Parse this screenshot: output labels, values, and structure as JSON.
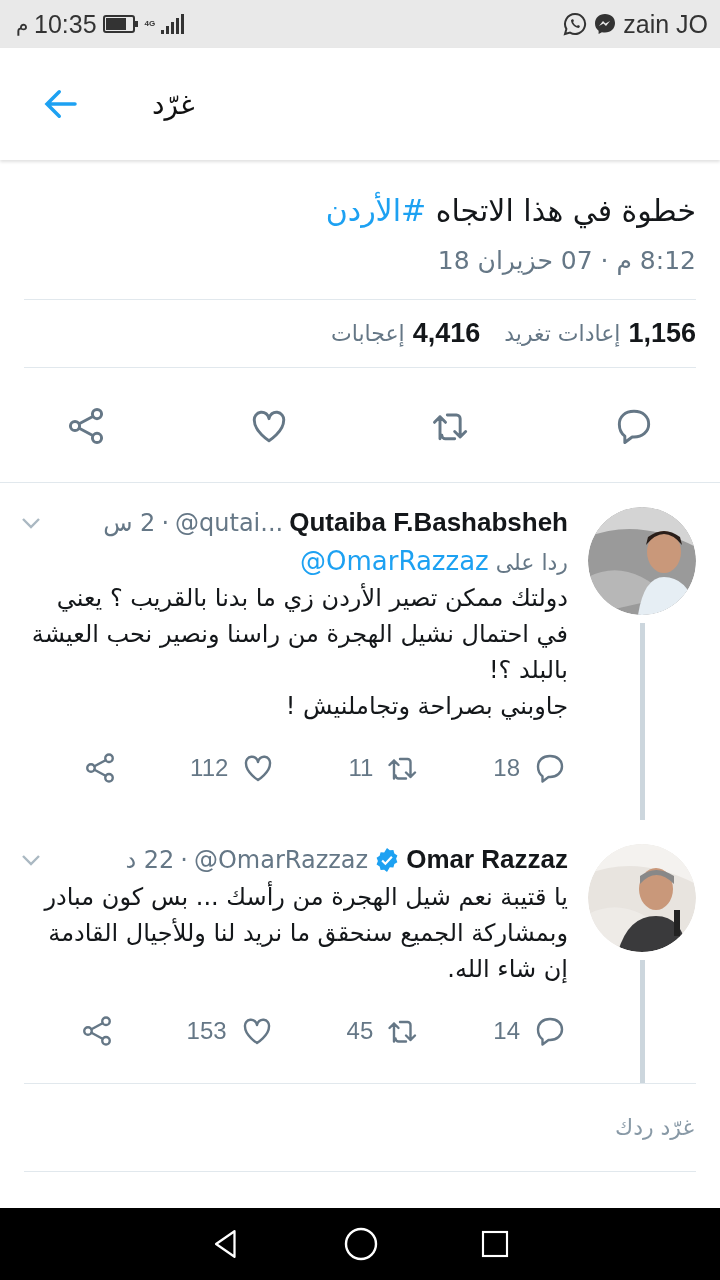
{
  "status_bar": {
    "carrier": "zain JO",
    "network": "4G",
    "time": "10:35",
    "time_suffix": "م"
  },
  "header": {
    "title": "غرّد"
  },
  "tweet": {
    "text": "خطوة في هذا الاتجاه",
    "hashtag": "#الأردن",
    "timestamp": "8:12 م · 07 حزيران 18",
    "stats": [
      {
        "count": "1,156",
        "label": "إعادات تغريد"
      },
      {
        "count": "4,416",
        "label": "إعجابات"
      }
    ],
    "actions": [
      {
        "kind": "reply"
      },
      {
        "kind": "retweet"
      },
      {
        "kind": "like"
      },
      {
        "kind": "share"
      }
    ]
  },
  "replies": [
    {
      "name": "Qutaiba F.Bashabsheh",
      "verified": false,
      "handle": "@qutai...",
      "separator": "·",
      "time": "2 س",
      "reply_prefix": "ردا على",
      "reply_to": "@OmarRazzaz",
      "text": "دولتك ممكن تصير الأردن زي ما بدنا بالقريب ؟ يعني في احتمال نشيل الهجرة من راسنا ونصير نحب العيشة بالبلد ؟!\nجاوبني بصراحة وتجاملنيش !",
      "actions": [
        {
          "kind": "reply",
          "count": "18"
        },
        {
          "kind": "retweet",
          "count": "11"
        },
        {
          "kind": "like",
          "count": "112"
        },
        {
          "kind": "share"
        }
      ]
    },
    {
      "name": "Omar Razzaz",
      "verified": true,
      "handle": "@OmarRazzaz",
      "separator": "·",
      "time": "22 د",
      "text": "يا قتيبة  نعم شيل الهجرة من رأسك ... بس كون مبادر  وبمشاركة الجميع سنحقق ما نريد لنا وللأجيال القادمة إن شاء الله.",
      "actions": [
        {
          "kind": "reply",
          "count": "14"
        },
        {
          "kind": "retweet",
          "count": "45"
        },
        {
          "kind": "like",
          "count": "153"
        },
        {
          "kind": "share"
        }
      ]
    }
  ],
  "composer": {
    "placeholder": "غرّد ردك"
  }
}
